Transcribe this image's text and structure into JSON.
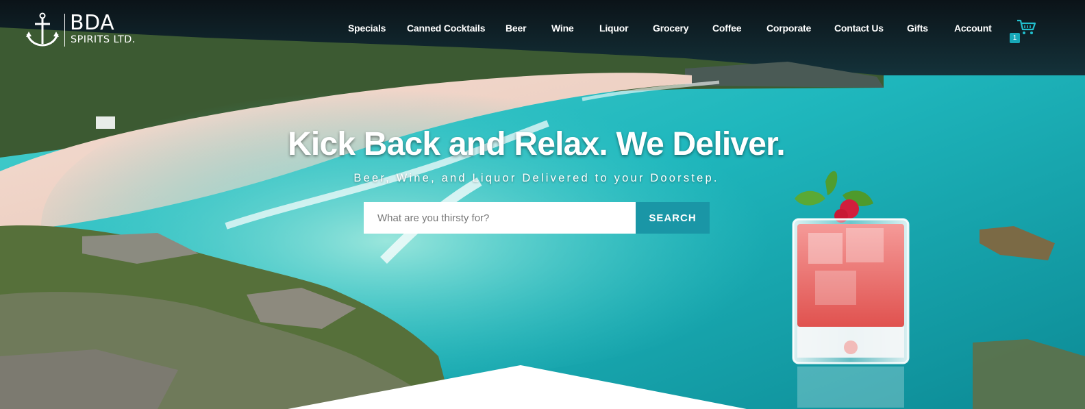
{
  "header": {
    "logo": {
      "brand": "BDA",
      "sub": "SPIRITS LTD."
    },
    "nav": [
      {
        "label": "Specials"
      },
      {
        "label": "Canned Cocktails"
      },
      {
        "label": "Beer"
      },
      {
        "label": "Wine"
      },
      {
        "label": "Liquor"
      },
      {
        "label": "Grocery"
      },
      {
        "label": "Coffee"
      },
      {
        "label": "Corporate"
      },
      {
        "label": "Contact Us"
      },
      {
        "label": "Gifts"
      },
      {
        "label": "Account"
      }
    ],
    "cart": {
      "icon": "cart-icon",
      "count": "1"
    }
  },
  "hero": {
    "headline": "Kick Back and Relax. We Deliver.",
    "subline": "Beer, Wine, and Liquor Delivered to your Doorstep.",
    "search": {
      "placeholder": "What are you thirsty for?",
      "value": "",
      "button_label": "SEARCH"
    }
  },
  "colors": {
    "accent": "#1a96a6",
    "badge": "#17a8b8",
    "text": "#ffffff"
  }
}
